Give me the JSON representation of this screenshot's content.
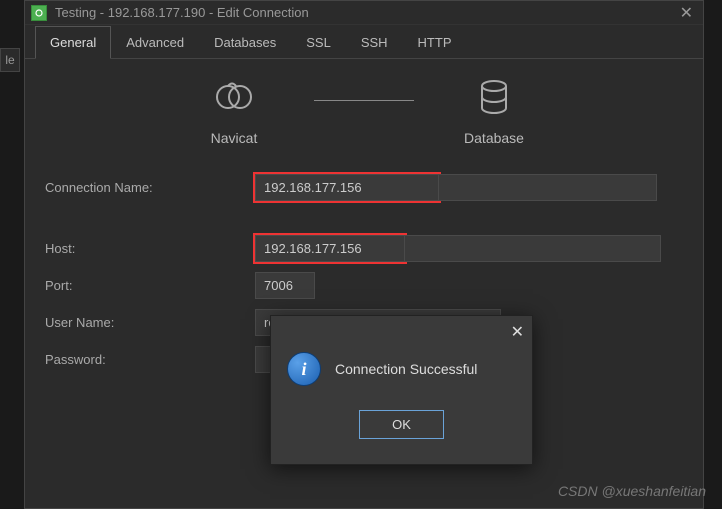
{
  "titlebar": {
    "title": "Testing - 192.168.177.190 - Edit Connection"
  },
  "tabs": {
    "general": "General",
    "advanced": "Advanced",
    "databases": "Databases",
    "ssl": "SSL",
    "ssh": "SSH",
    "http": "HTTP"
  },
  "diagram": {
    "left_label": "Navicat",
    "right_label": "Database"
  },
  "form": {
    "connection_name_label": "Connection Name:",
    "connection_name_value": "192.168.177.156",
    "host_label": "Host:",
    "host_value": "192.168.177.156",
    "port_label": "Port:",
    "port_value": "7006",
    "username_label": "User Name:",
    "username_value": "root",
    "password_label": "Password:",
    "password_value": ""
  },
  "dialog": {
    "message": "Connection Successful",
    "ok_label": "OK"
  },
  "sidebar_fragment": "le",
  "watermark": "CSDN @xueshanfeitian"
}
